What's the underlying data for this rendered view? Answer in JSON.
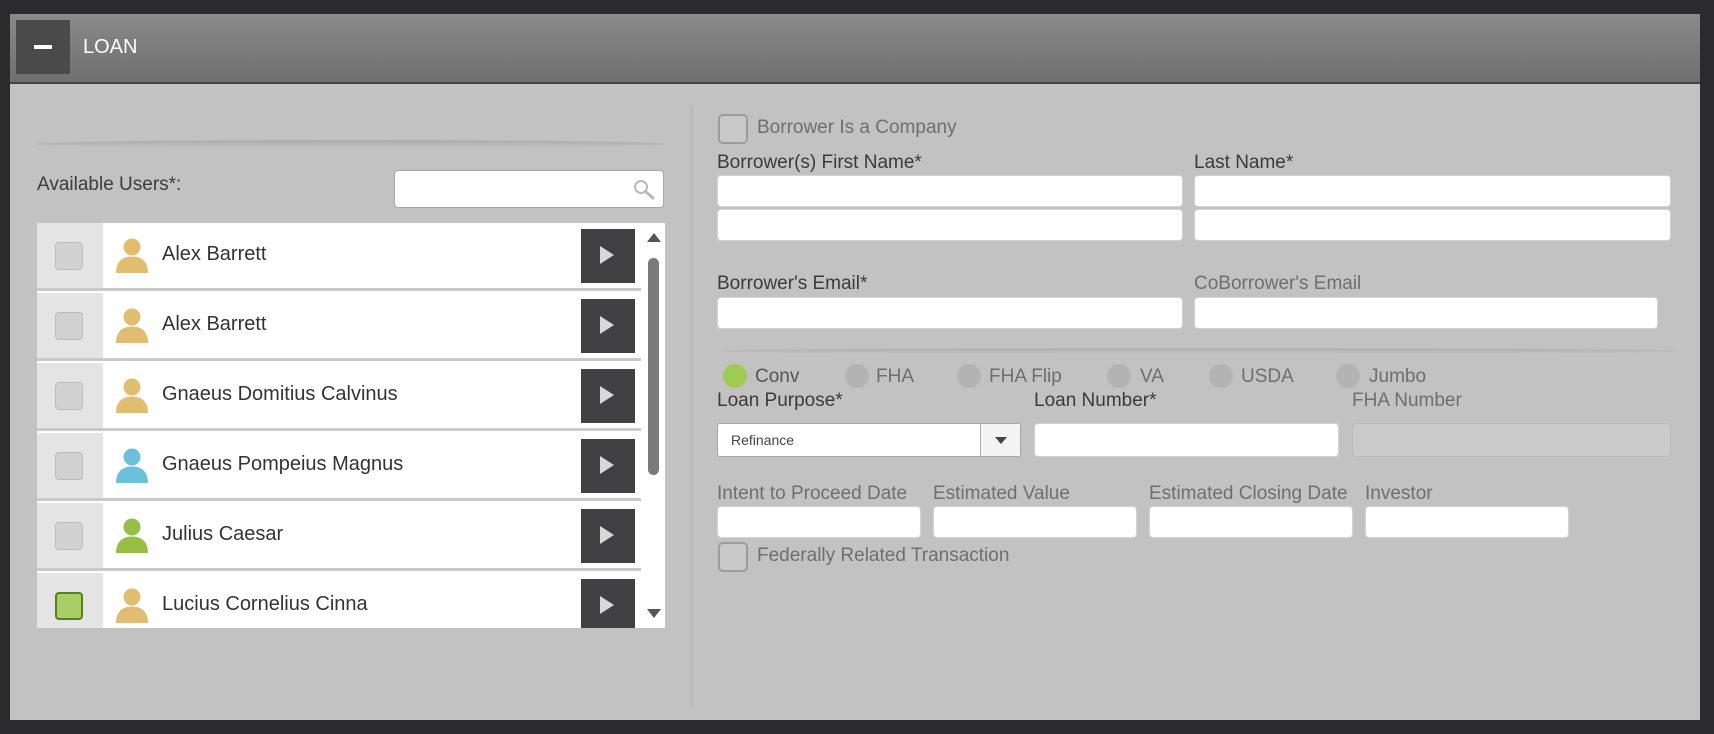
{
  "header": {
    "title": "LOAN"
  },
  "users_panel": {
    "label": "Available Users*:",
    "search_placeholder": "",
    "users": [
      {
        "name": "Alex Barrett",
        "checked": false,
        "icon_color": "#e1bd71"
      },
      {
        "name": "Alex Barrett",
        "checked": false,
        "icon_color": "#e1bd71"
      },
      {
        "name": "Gnaeus Domitius Calvinus",
        "checked": false,
        "icon_color": "#e1bd71"
      },
      {
        "name": "Gnaeus Pompeius Magnus",
        "checked": false,
        "icon_color": "#6cc0d9"
      },
      {
        "name": "Julius Caesar",
        "checked": false,
        "icon_color": "#97bf48"
      },
      {
        "name": "Lucius Cornelius Cinna",
        "checked": true,
        "icon_color": "#e1bd71"
      }
    ]
  },
  "form": {
    "borrower_company_label": "Borrower Is a Company",
    "first_name_label": "Borrower(s) First Name*",
    "last_name_label": "Last Name*",
    "borrower_email_label": "Borrower's Email*",
    "coborrower_email_label": "CoBorrower's Email",
    "loan_types": [
      {
        "label": "Conv",
        "selected": true
      },
      {
        "label": "FHA",
        "selected": false
      },
      {
        "label": "FHA Flip",
        "selected": false
      },
      {
        "label": "VA",
        "selected": false
      },
      {
        "label": "USDA",
        "selected": false
      },
      {
        "label": "Jumbo",
        "selected": false
      }
    ],
    "loan_purpose_label": "Loan Purpose*",
    "loan_purpose_value": "Refinance",
    "loan_number_label": "Loan Number*",
    "fha_number_label": "FHA Number",
    "intent_date_label": "Intent to Proceed Date",
    "estimated_value_label": "Estimated Value",
    "estimated_closing_label": "Estimated Closing Date",
    "investor_label": "Investor",
    "federal_label": "Federally Related Transaction"
  }
}
